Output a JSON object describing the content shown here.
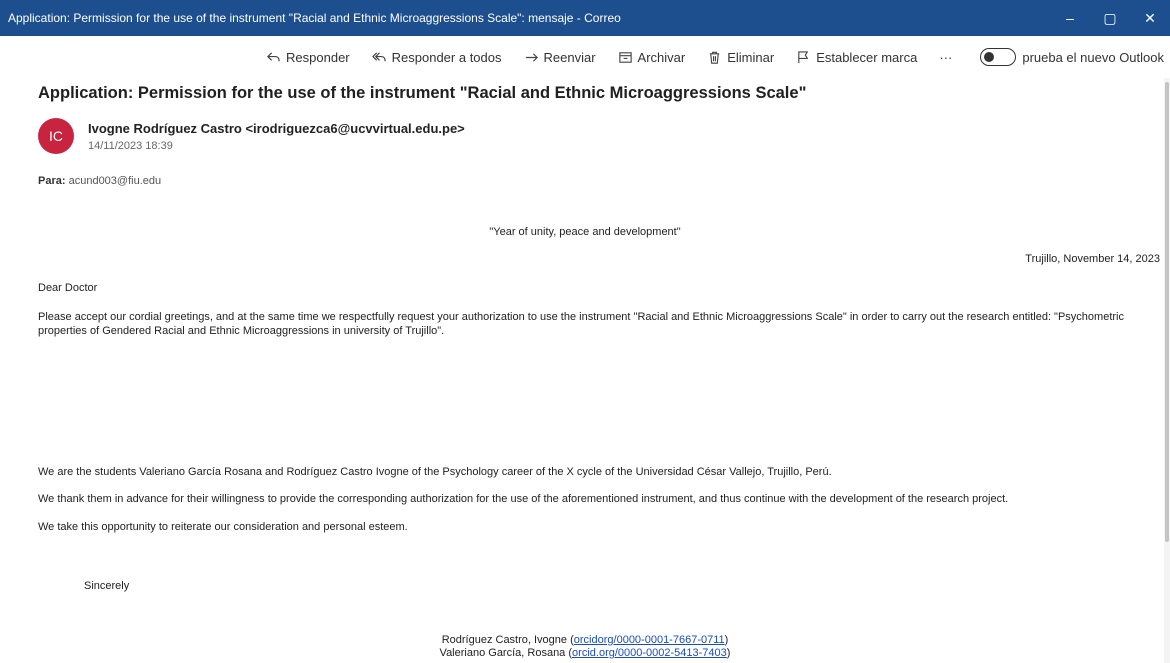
{
  "window": {
    "title": "Application: Permission for the use of the instrument \"Racial and Ethnic Microaggressions Scale\": mensaje - Correo",
    "minimize": "–",
    "restore": "▢",
    "close": "✕"
  },
  "toolbar": {
    "reply": "Responder",
    "reply_all": "Responder a todos",
    "forward": "Reenviar",
    "archive": "Archivar",
    "delete": "Eliminar",
    "flag": "Establecer marca",
    "more": "···",
    "toggle_label": "prueba el nuevo Outlook"
  },
  "message": {
    "subject": "Application: Permission for the use of the instrument \"Racial and Ethnic Microaggressions Scale\"",
    "avatar_initials": "IC",
    "avatar_color": "#c8233f",
    "sender": "Ivogne Rodríguez Castro <irodriguezca6@ucvvirtual.edu.pe>",
    "date": "14/11/2023 18:39",
    "to_label": "Para:",
    "to_value": "acund003@fiu.edu"
  },
  "body": {
    "motto": "\"Year of unity, peace and development\"",
    "place_date": "Trujillo, November 14, 2023",
    "greeting": "Dear Doctor",
    "para1": "Please accept our cordial greetings, and at the same time we respectfully request your authorization to use the instrument \"Racial and Ethnic Microaggressions Scale\" in order to carry out the research entitled: \"Psychometric properties of Gendered Racial and Ethnic Microaggressions in university of Trujillo\".",
    "para2": "We are the students Valeriano García Rosana and Rodríguez Castro Ivogne of the Psychology career of the X cycle of the Universidad César Vallejo, Trujillo, Perú.",
    "para3": "We thank them in advance for their willingness to provide the corresponding authorization for the use of the aforementioned instrument, and thus continue with the development of the research project.",
    "para4": "We take this opportunity to reiterate our consideration and personal esteem.",
    "closing": "Sincerely",
    "sig1_name": "Rodríguez Castro, Ivogne",
    "sig1_link": "orcidorg/0000-0001-7667-0711",
    "sig2_name": "Valeriano García, Rosana",
    "sig2_link": "orcid.org/0000-0002-5413-7403"
  },
  "colors": {
    "titlebar": "#1d4f8f",
    "link": "#1a4db8"
  }
}
